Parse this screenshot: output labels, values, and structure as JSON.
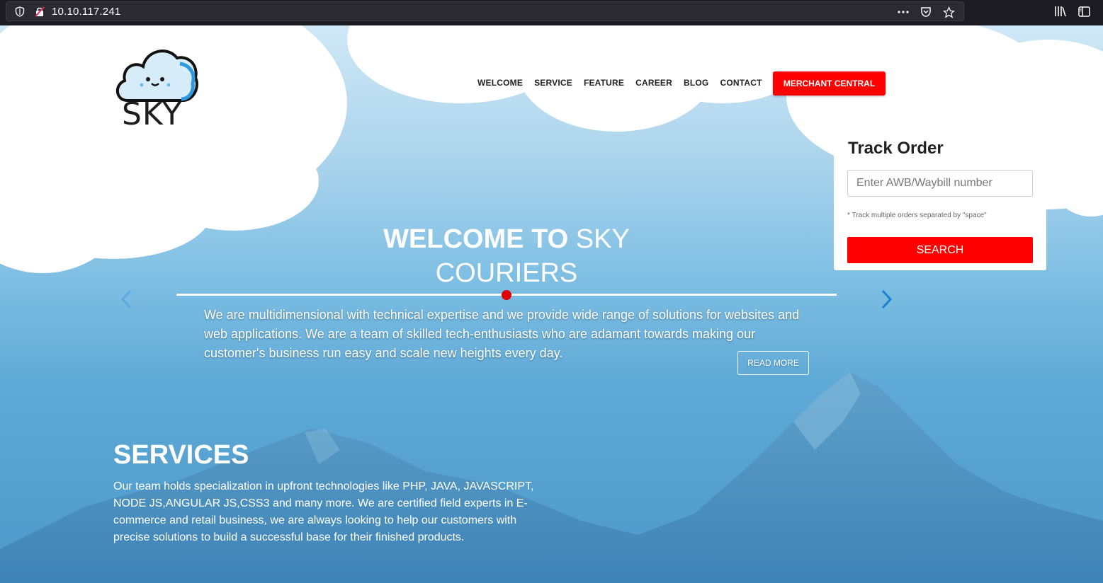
{
  "browser": {
    "url": "10.10.117.241",
    "actions": [
      "more-icon",
      "pocket-icon",
      "star-icon"
    ],
    "toolbar": [
      "library-icon",
      "sidebar-icon"
    ]
  },
  "brand": {
    "name": "SKY"
  },
  "nav": {
    "items": [
      "WELCOME",
      "SERVICE",
      "FEATURE",
      "CAREER",
      "BLOG",
      "CONTACT"
    ],
    "merchant_button": "MERCHANT CENTRAL"
  },
  "track": {
    "title": "Track Order",
    "placeholder": "Enter AWB/Waybill number",
    "hint": "* Track multiple orders separated by \"space\"",
    "button": "SEARCH"
  },
  "hero": {
    "title_bold": "WELCOME TO",
    "title_light_1": "SKY",
    "title_light_2": "COURIERS",
    "text": "We are multidimensional with technical expertise and we provide wide range of solutions for websites and web applications. We are a team of skilled tech-enthusiasts who are adamant towards making our customer's business run easy and scale new heights every day.",
    "button": "READ MORE"
  },
  "services": {
    "title": "SERVICES",
    "text": "Our team holds specialization in upfront technologies like PHP, JAVA, JAVASCRIPT, NODE JS,ANGULAR JS,CSS3 and many more. We are certified field experts in E-commerce and retail business, we are always looking to help our customers with precise solutions to build a successful base for their finished products."
  },
  "colors": {
    "accent": "#ff0000",
    "arrow": "#2e8bd6"
  }
}
